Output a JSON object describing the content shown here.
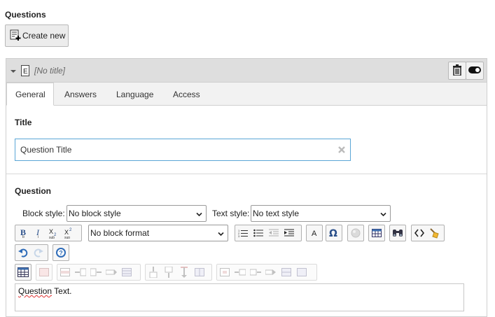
{
  "questions": {
    "heading": "Questions",
    "create_label": "Create new"
  },
  "question_panel": {
    "title_placeholder": "[No title]",
    "tabs": [
      {
        "label": "General",
        "active": true
      },
      {
        "label": "Answers",
        "active": false
      },
      {
        "label": "Language",
        "active": false
      },
      {
        "label": "Access",
        "active": false
      }
    ],
    "title_section_label": "Title",
    "title_value": "Question Title",
    "question_section_label": "Question",
    "block_style_label": "Block style:",
    "block_style_value": "No block style",
    "text_style_label": "Text style:",
    "text_style_value": "No text style",
    "block_format_value": "No block format",
    "editor_text_first": "Question",
    "editor_text_rest": " Text.",
    "toggle_on": true
  },
  "colors": {
    "focus_border": "#5aa6d6",
    "header_bg": "#dedede",
    "help_blue": "#2d6bb8",
    "spell_error": "#e03030"
  },
  "icons": [
    "collapse-caret-icon",
    "element-type-icon",
    "trash-icon",
    "toggle-icon",
    "create-new-icon",
    "clear-icon",
    "bold-icon",
    "italic-icon",
    "subscript-icon",
    "superscript-icon",
    "ordered-list-icon",
    "unordered-list-icon",
    "outdent-icon",
    "indent-icon",
    "text-color-icon",
    "special-char-icon",
    "image-icon",
    "table-icon",
    "find-replace-icon",
    "code-icon",
    "cleanup-icon",
    "undo-icon",
    "redo-icon",
    "help-icon"
  ]
}
